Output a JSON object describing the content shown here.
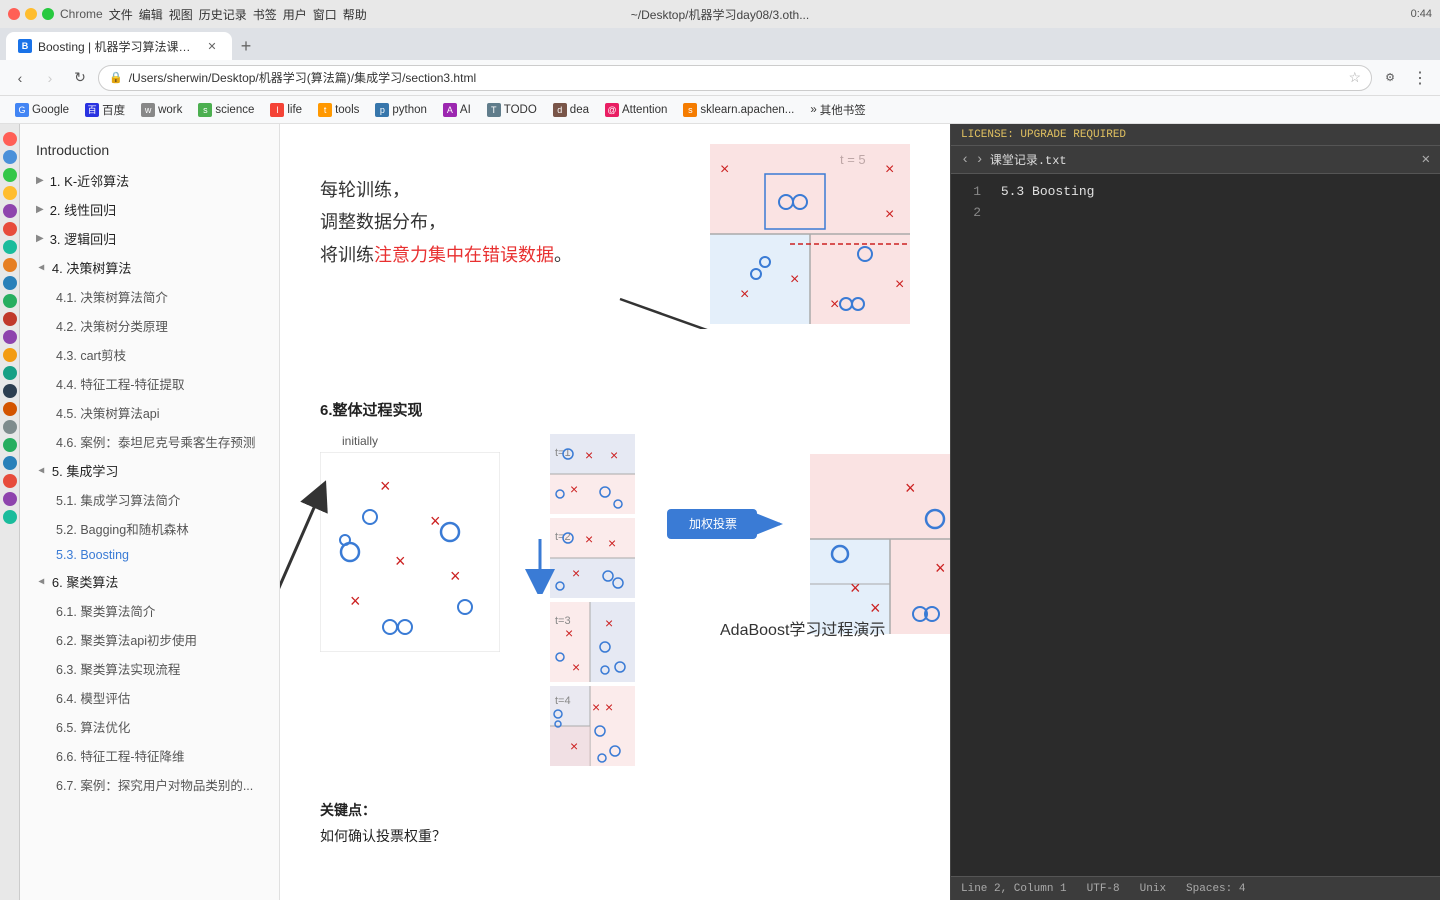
{
  "titleBar": {
    "title": "~/Desktop/机器学习day08/3.oth...",
    "rightText": "LICENSE: UPGRADE REQUIRED",
    "time": "0:44"
  },
  "chromeTab": {
    "label": "Boosting | 机器学习算法课程Z...",
    "url": "/Users/sherwin/Desktop/机器学习(算法篇)/集成学习/section3.html"
  },
  "bookmarks": [
    {
      "label": "Google",
      "icon": "G"
    },
    {
      "label": "百度",
      "icon": "百"
    },
    {
      "label": "work",
      "icon": "w"
    },
    {
      "label": "science",
      "icon": "s"
    },
    {
      "label": "life",
      "icon": "l"
    },
    {
      "label": "tools",
      "icon": "t"
    },
    {
      "label": "python",
      "icon": "p"
    },
    {
      "label": "AI",
      "icon": "A"
    },
    {
      "label": "TODO",
      "icon": "T"
    },
    {
      "label": "dea",
      "icon": "d"
    },
    {
      "label": "Attention",
      "icon": "@"
    },
    {
      "label": "sklearn.apachen...",
      "icon": "s"
    },
    {
      "label": "其他书签",
      "icon": "»"
    }
  ],
  "sidebar": {
    "introLabel": "Introduction",
    "items": [
      {
        "label": "1. K-近邻算法",
        "level": "top",
        "collapsed": true
      },
      {
        "label": "2. 线性回归",
        "level": "top",
        "collapsed": true
      },
      {
        "label": "3. 逻辑回归",
        "level": "top",
        "collapsed": true
      },
      {
        "label": "4. 决策树算法",
        "level": "top",
        "collapsed": false
      },
      {
        "label": "4.1. 决策树算法简介",
        "level": "sub"
      },
      {
        "label": "4.2. 决策树分类原理",
        "level": "sub"
      },
      {
        "label": "4.3. cart剪枝",
        "level": "sub"
      },
      {
        "label": "4.4. 特征工程-特征提取",
        "level": "sub"
      },
      {
        "label": "4.5. 决策树算法api",
        "level": "sub"
      },
      {
        "label": "4.6. 案例：泰坦尼克号乘客生存预测",
        "level": "sub"
      },
      {
        "label": "5. 集成学习",
        "level": "top",
        "collapsed": false
      },
      {
        "label": "5.1. 集成学习算法简介",
        "level": "sub"
      },
      {
        "label": "5.2. Bagging和随机森林",
        "level": "sub"
      },
      {
        "label": "5.3. Boosting",
        "level": "sub",
        "active": true
      },
      {
        "label": "6. 聚类算法",
        "level": "top",
        "collapsed": false
      },
      {
        "label": "6.1. 聚类算法简介",
        "level": "sub"
      },
      {
        "label": "6.2. 聚类算法api初步使用",
        "level": "sub"
      },
      {
        "label": "6.3. 聚类算法实现流程",
        "level": "sub"
      },
      {
        "label": "6.4. 模型评估",
        "level": "sub"
      },
      {
        "label": "6.5. 算法优化",
        "level": "sub"
      },
      {
        "label": "6.6. 特征工程-特征降维",
        "level": "sub"
      },
      {
        "label": "6.7. 案例：探究用户对物品类别的...",
        "level": "sub"
      }
    ]
  },
  "content": {
    "trainingDesc1": "每轮训练，",
    "trainingDesc2": "调整数据分布，",
    "trainingDesc3Part1": "将训练",
    "trainingDesc3Highlight": "注意力集中在错误数据",
    "trainingDesc3Part2": "。",
    "section6Title": "6.整体过程实现",
    "adaboostLabel": "AdaBoost学习过程演示",
    "weightedVoteLabel": "加权投票",
    "initiallyLabel": "initially",
    "tLabel": "t = 5",
    "keyPointsTitle": "关键点：",
    "keyPointsQuestion": "如何确认投票权重？"
  },
  "rightPanel": {
    "filename": "课堂记录.txt",
    "lines": [
      {
        "num": "1",
        "text": "5.3 Boosting"
      },
      {
        "num": "2",
        "text": ""
      }
    ],
    "footer": {
      "line": "Line 2, Column 1",
      "encoding": "UTF-8",
      "lineEnding": "Unix",
      "spaces": "Spaces: 4"
    }
  }
}
